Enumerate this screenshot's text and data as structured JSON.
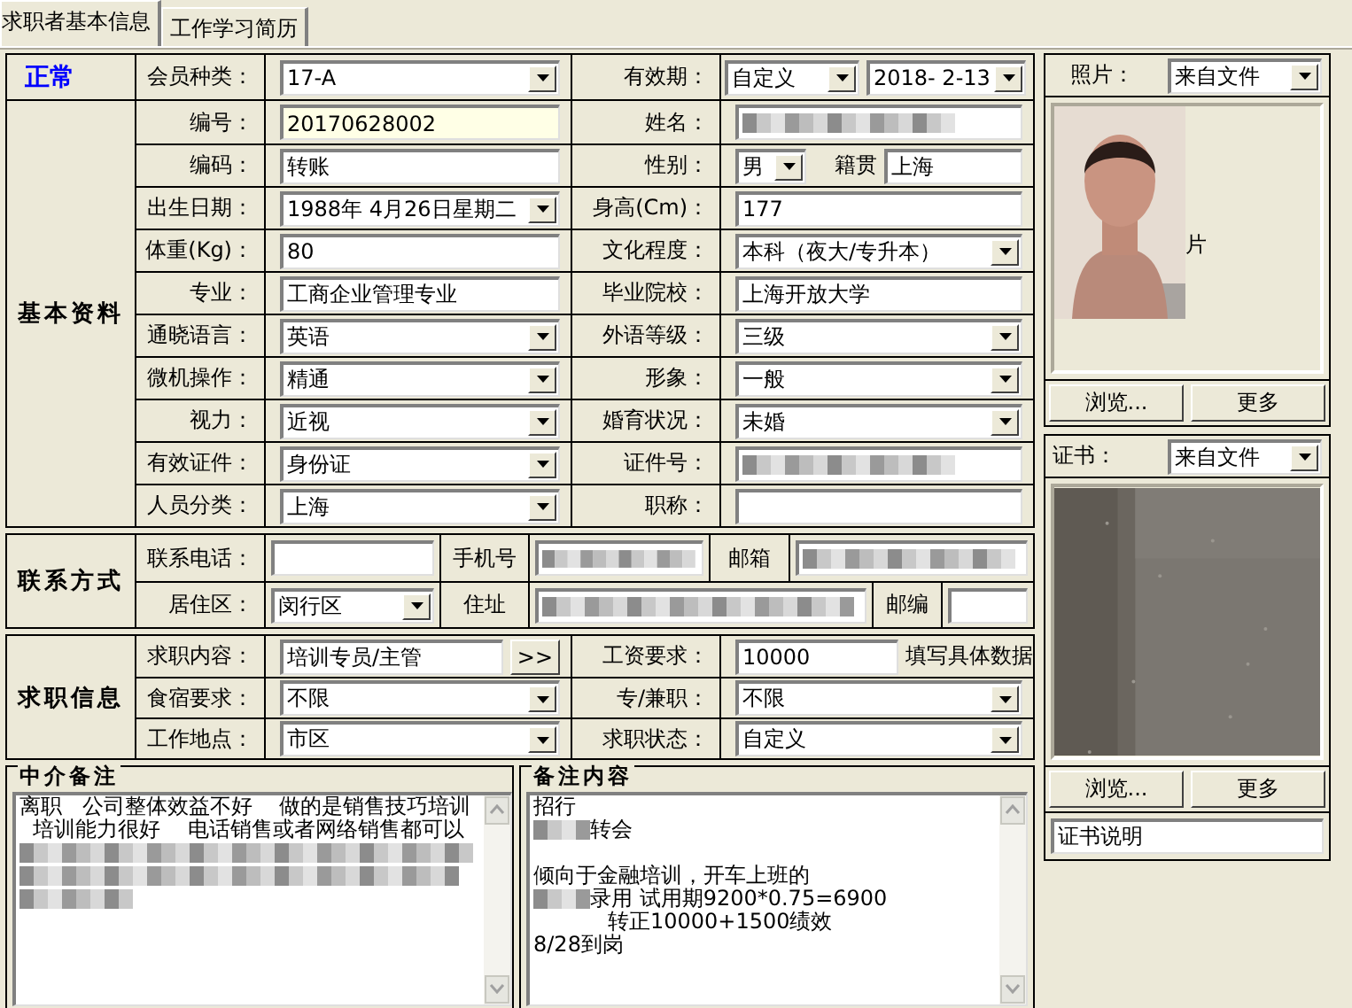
{
  "tabs": [
    {
      "label": "求职者基本信息",
      "selected": true
    },
    {
      "label": "工作学习简历",
      "selected": false
    }
  ],
  "status": "正常",
  "header": {
    "member_type": {
      "label": "会员种类：",
      "kind": "combo",
      "value": "17-A"
    },
    "validity": {
      "label": "有效期：",
      "kind": "combo_pair",
      "values": [
        "自定义",
        "2018- 2-13"
      ]
    }
  },
  "basic": {
    "title": "基本资料",
    "rows": [
      {
        "left": {
          "label": "编号：",
          "kind": "text",
          "value": "20170628002",
          "highlighted": true
        },
        "right": {
          "label": "姓名：",
          "kind": "text",
          "redacted": true
        }
      },
      {
        "left": {
          "label": "编码：",
          "kind": "text",
          "value": "转账"
        },
        "right": {
          "label": "性别：",
          "kind": "combo_extra",
          "value": "男",
          "extra_label": "籍贯",
          "extra_value": "上海"
        }
      },
      {
        "left": {
          "label": "出生日期：",
          "kind": "combo",
          "value": "1988年 4月26日星期二"
        },
        "right": {
          "label": "身高(Cm)：",
          "kind": "text",
          "value": "177"
        }
      },
      {
        "left": {
          "label": "体重(Kg)：",
          "kind": "text",
          "value": "80"
        },
        "right": {
          "label": "文化程度：",
          "kind": "combo",
          "value": "本科（夜大/专升本）"
        }
      },
      {
        "left": {
          "label": "专业：",
          "kind": "text",
          "value": "工商企业管理专业"
        },
        "right": {
          "label": "毕业院校：",
          "kind": "text",
          "value": "上海开放大学"
        }
      },
      {
        "left": {
          "label": "通晓语言：",
          "kind": "combo",
          "value": "英语"
        },
        "right": {
          "label": "外语等级：",
          "kind": "combo",
          "value": "三级"
        }
      },
      {
        "left": {
          "label": "微机操作：",
          "kind": "combo",
          "value": "精通"
        },
        "right": {
          "label": "形象：",
          "kind": "combo",
          "value": "一般"
        }
      },
      {
        "left": {
          "label": "视力：",
          "kind": "combo",
          "value": "近视"
        },
        "right": {
          "label": "婚育状况：",
          "kind": "combo",
          "value": "未婚"
        }
      },
      {
        "left": {
          "label": "有效证件：",
          "kind": "combo",
          "value": "身份证"
        },
        "right": {
          "label": "证件号：",
          "kind": "text",
          "redacted": true
        }
      },
      {
        "left": {
          "label": "人员分类：",
          "kind": "combo",
          "value": "上海"
        },
        "right": {
          "label": "职称：",
          "kind": "text"
        }
      }
    ]
  },
  "contact": {
    "title": "联系方式",
    "rows": [
      [
        {
          "kind": "label",
          "text": "联系电话："
        },
        {
          "kind": "text"
        },
        {
          "kind": "label",
          "text": "手机号"
        },
        {
          "kind": "text",
          "redacted": true
        },
        {
          "kind": "label",
          "text": "邮箱"
        },
        {
          "kind": "text",
          "redacted": true
        }
      ],
      [
        {
          "kind": "label",
          "text": "居住区："
        },
        {
          "kind": "combo",
          "value": "闵行区"
        },
        {
          "kind": "label",
          "text": "住址"
        },
        {
          "kind": "text",
          "redacted": true
        },
        {
          "kind": "label",
          "text": "邮编"
        },
        {
          "kind": "text"
        }
      ]
    ]
  },
  "job": {
    "title": "求职信息",
    "rows": [
      {
        "left": {
          "label": "求职内容：",
          "kind": "text_more",
          "value": "培训专员/主管",
          "button": ">>"
        },
        "right": {
          "label": "工资要求：",
          "kind": "text_hint",
          "value": "10000",
          "hint": "填写具体数据"
        }
      },
      {
        "left": {
          "label": "食宿要求：",
          "kind": "combo",
          "value": "不限"
        },
        "right": {
          "label": "专/兼职：",
          "kind": "combo",
          "value": "不限"
        }
      },
      {
        "left": {
          "label": "工作地点：",
          "kind": "combo",
          "value": "市区"
        },
        "right": {
          "label": "求职状态：",
          "kind": "combo",
          "value": "自定义"
        }
      }
    ]
  },
  "notes": [
    {
      "title": "中介备注",
      "lines": [
        {
          "text": "离职   公司整体效益不好    做的是销售技巧培训"
        },
        {
          "text": "  培训能力很好    电话销售或者网络销售都可以"
        },
        {
          "redacted": true
        },
        {
          "redacted": true
        },
        {
          "redacted": true
        }
      ]
    },
    {
      "title": "备注内容",
      "lines": [
        {
          "text": "招行"
        },
        {
          "text": "转会",
          "redacted": true
        },
        {
          "text": "倾向于金融培训，开车上班的",
          "gap_before": true
        },
        {
          "text": "录用 试用期9200*0.75=6900",
          "redacted": true
        },
        {
          "text": "           转正10000+1500绩效"
        },
        {
          "text": "8/28到岗"
        }
      ]
    }
  ],
  "photo": {
    "label": "照片：",
    "source": "来自文件",
    "caption": "片",
    "buttons": [
      "浏览...",
      "更多"
    ]
  },
  "certificate": {
    "label": "证书：",
    "source": "来自文件",
    "buttons": [
      "浏览...",
      "更多"
    ],
    "description": "证书说明"
  }
}
